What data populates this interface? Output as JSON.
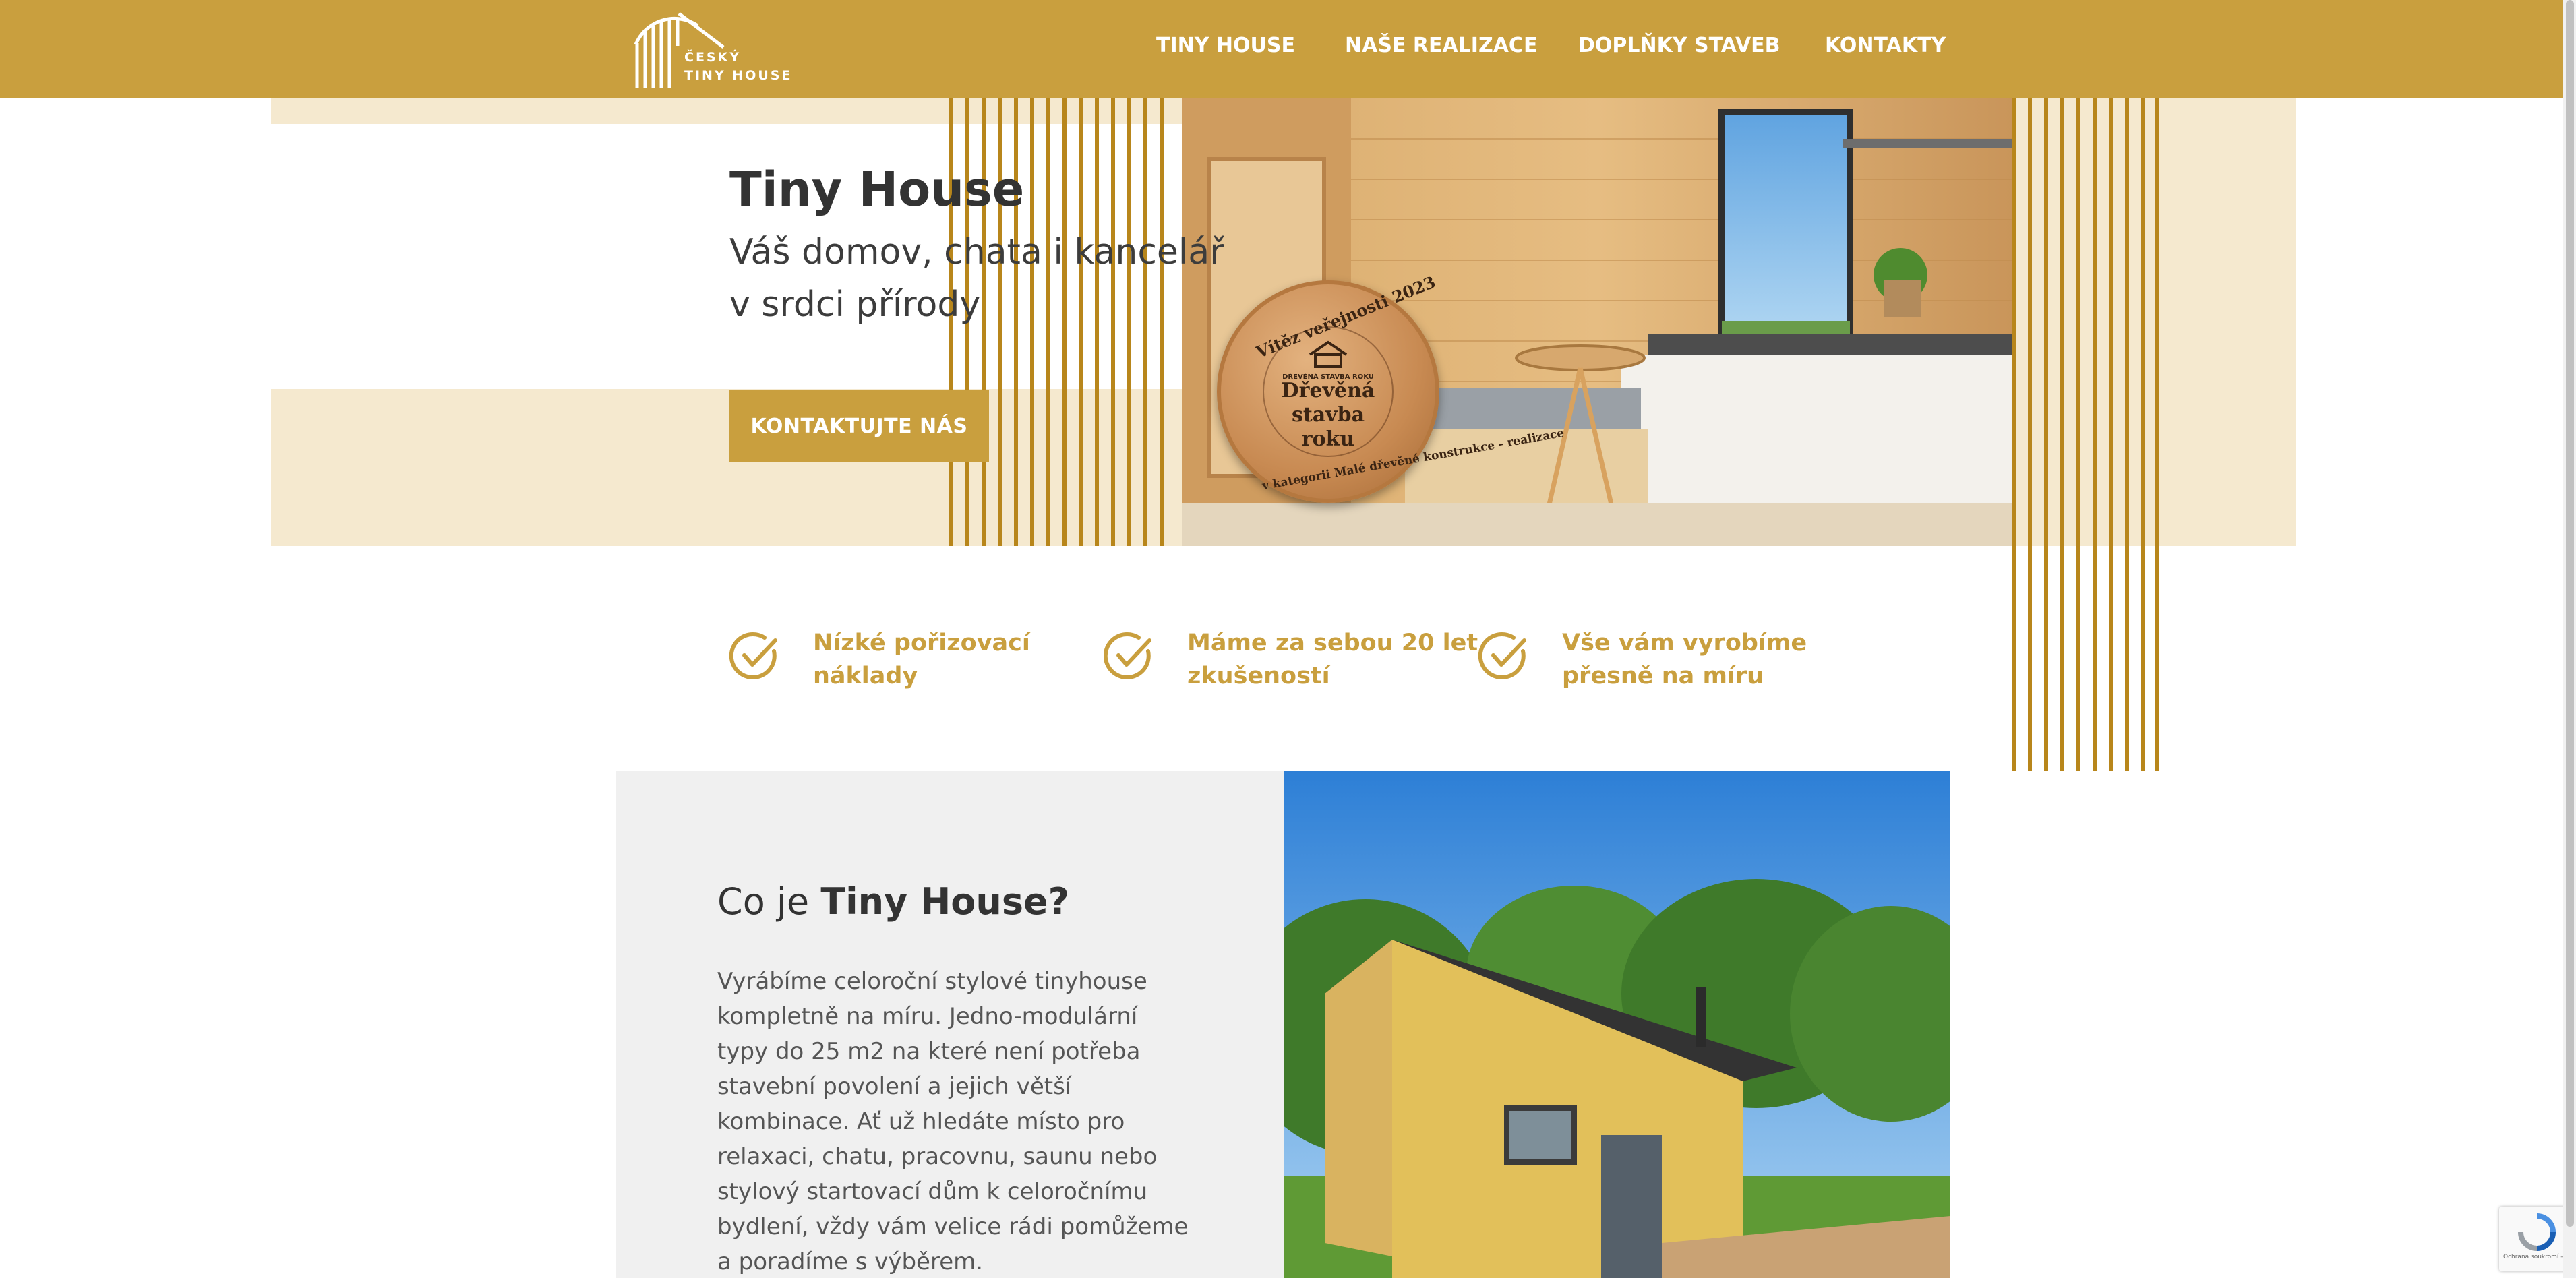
{
  "header": {
    "logo_line1": "ČESKÝ",
    "logo_line2": "TINY HOUSE",
    "nav": [
      {
        "label": "TINY HOUSE"
      },
      {
        "label": "NAŠE REALIZACE"
      },
      {
        "label": "DOPLŇKY STAVEB"
      },
      {
        "label": "KONTAKTY"
      }
    ]
  },
  "hero": {
    "title": "Tiny House",
    "subtitle_line1": "Váš domov, chata i kancelář",
    "subtitle_line2": "v srdci přírody",
    "cta_label": "KONTAKTUJTE NÁS"
  },
  "badge": {
    "top_text": "Vítěz veřejnosti 2023",
    "mark_label": "DŘEVĚNÁ STAVBA ROKU",
    "main_line1": "Dřevěná",
    "main_line2": "stavba",
    "main_line3": "roku",
    "bottom_text": "v kategorii Malé dřevěné konstrukce - realizace"
  },
  "features": [
    {
      "line1": "Nízké pořizovací",
      "line2": "náklady"
    },
    {
      "line1": "Máme za sebou 20 let",
      "line2": "zkušeností"
    },
    {
      "line1": "Vše vám vyrobíme",
      "line2": "přesně na míru"
    }
  ],
  "about": {
    "title_light": "Co je ",
    "title_bold": "Tiny House?",
    "body": "Vyrábíme celoroční stylové tinyhouse kompletně na míru. Jedno-modulární typy do 25 m2 na které není potřeba stavební povolení a jejich větší kombinace. Ať už hledáte místo pro relaxaci, chatu, pracovnu, saunu nebo stylový startovací dům k celoročnímu bydlení, vždy vám velice rádi pomůžeme a poradíme s výběrem."
  },
  "recaptcha": {
    "footer": "Ochrana soukromí - Smluvní podmínky"
  },
  "colors": {
    "brand_gold": "#c99f3e",
    "stripe_gold": "#b8861b",
    "hero_beige": "#f5e9cf"
  }
}
